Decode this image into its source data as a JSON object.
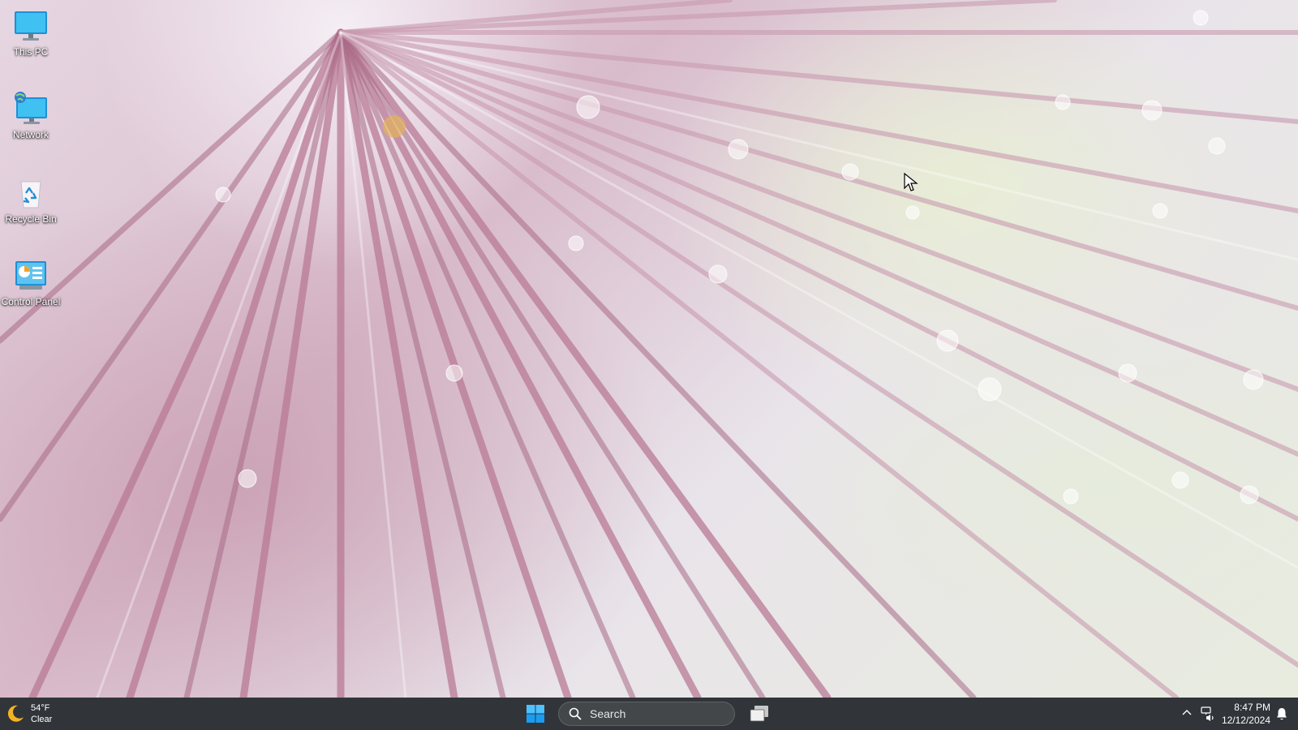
{
  "desktop": {
    "icons": [
      {
        "label": "This PC",
        "icon": "monitor-icon"
      },
      {
        "label": "Network",
        "icon": "network-icon"
      },
      {
        "label": "Recycle Bin",
        "icon": "recycle-bin-icon"
      },
      {
        "label": "Control Panel",
        "icon": "control-panel-icon"
      }
    ]
  },
  "taskbar": {
    "weather": {
      "temp": "54°F",
      "condition": "Clear",
      "icon": "moon-icon"
    },
    "start_icon": "windows-logo-icon",
    "search": {
      "placeholder": "Search",
      "icon": "search-icon"
    },
    "task_view_icon": "task-view-icon",
    "tray": {
      "chevron_icon": "chevron-up-icon",
      "network_icon": "network-volume-icon",
      "time": "8:47 PM",
      "date": "12/12/2024",
      "notification_icon": "bell-icon"
    },
    "accent_color": "#0078d4"
  }
}
